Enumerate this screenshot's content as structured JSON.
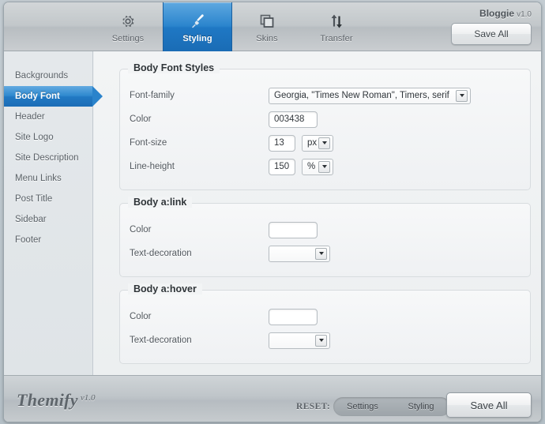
{
  "header": {
    "app_name": "Bloggie",
    "app_version": "v1.0",
    "save_label": "Save All",
    "tabs": [
      {
        "label": "Settings",
        "icon": "gear-icon",
        "active": false
      },
      {
        "label": "Styling",
        "icon": "brush-icon",
        "active": true
      },
      {
        "label": "Skins",
        "icon": "skins-icon",
        "active": false
      },
      {
        "label": "Transfer",
        "icon": "transfer-icon",
        "active": false
      }
    ]
  },
  "sidebar": {
    "items": [
      {
        "label": "Backgrounds",
        "active": false
      },
      {
        "label": "Body Font",
        "active": true
      },
      {
        "label": "Header",
        "active": false
      },
      {
        "label": "Site Logo",
        "active": false
      },
      {
        "label": "Site Description",
        "active": false
      },
      {
        "label": "Menu Links",
        "active": false
      },
      {
        "label": "Post Title",
        "active": false
      },
      {
        "label": "Sidebar",
        "active": false
      },
      {
        "label": "Footer",
        "active": false
      }
    ]
  },
  "panels": {
    "body_font_styles": {
      "legend": "Body Font Styles",
      "font_family": {
        "label": "Font-family",
        "value": "Georgia, \"Times New Roman\", Timers, serif"
      },
      "color": {
        "label": "Color",
        "value": "003438"
      },
      "font_size": {
        "label": "Font-size",
        "value": "13",
        "unit": "px"
      },
      "line_height": {
        "label": "Line-height",
        "value": "150",
        "unit": "%"
      }
    },
    "body_a_link": {
      "legend": "Body a:link",
      "color": {
        "label": "Color",
        "value": ""
      },
      "text_decoration": {
        "label": "Text-decoration",
        "value": ""
      }
    },
    "body_a_hover": {
      "legend": "Body a:hover",
      "color": {
        "label": "Color",
        "value": ""
      },
      "text_decoration": {
        "label": "Text-decoration",
        "value": ""
      }
    }
  },
  "footer": {
    "brand": "Themify",
    "brand_version": "v1.0",
    "reset_label": "RESET:",
    "reset_settings": "Settings",
    "reset_styling": "Styling",
    "save_label": "Save All"
  },
  "colors": {
    "accent": "#2a83cb",
    "toolbar": "#c2c7ca",
    "panel": "#f2f4f5",
    "sidebar": "#e4e8eb"
  }
}
